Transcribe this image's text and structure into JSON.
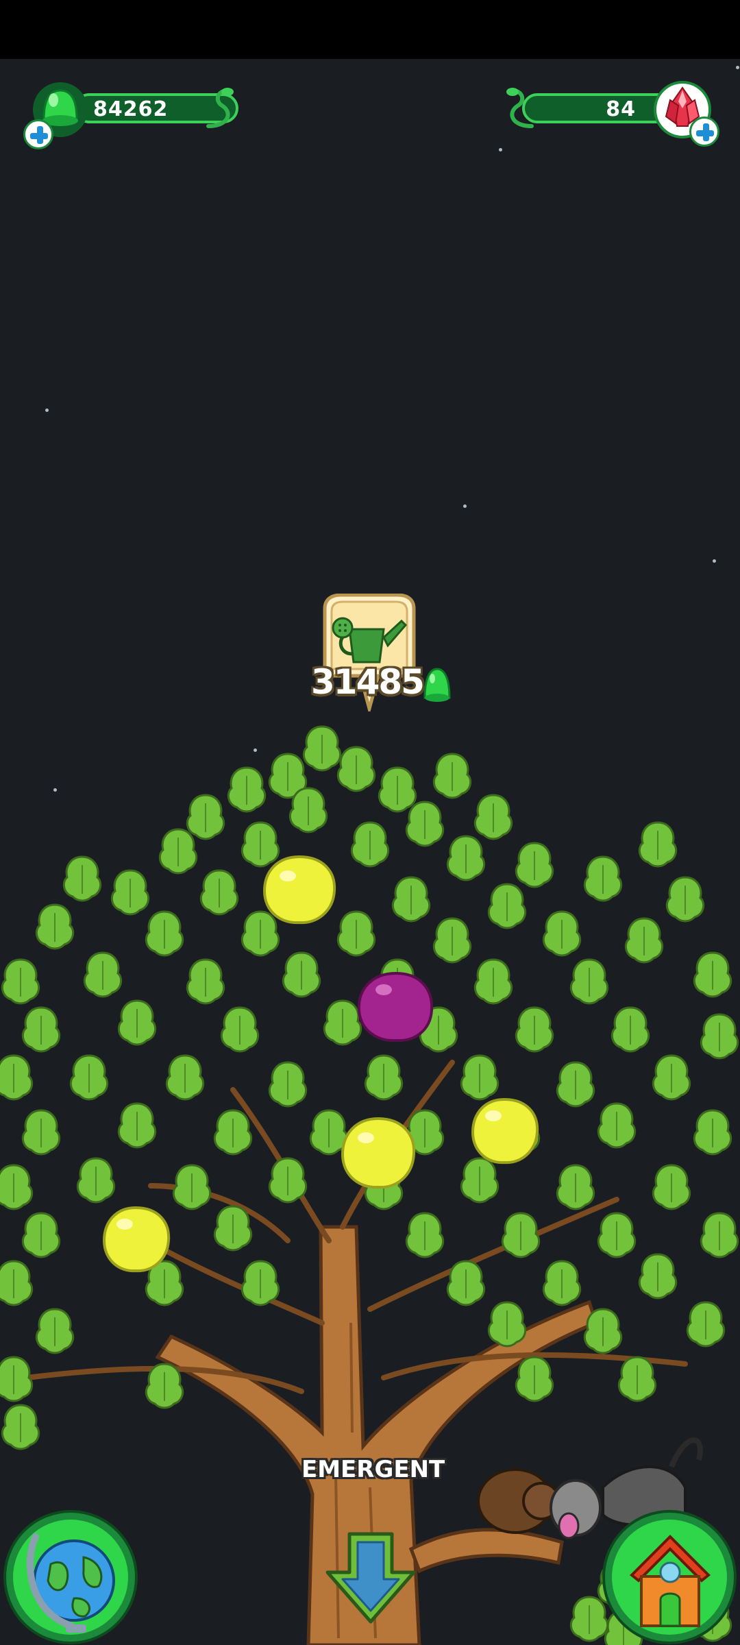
{
  "currencies": {
    "green_gems": {
      "value": "84262",
      "icon": "green-gem-icon"
    },
    "red_crystals": {
      "value": "84",
      "icon": "red-crystal-icon"
    }
  },
  "tree": {
    "water_cost": "31485",
    "water_icon": "watering-can-icon",
    "stage_label": "EMERGENT"
  },
  "fruits": [
    "yellow",
    "purple",
    "yellow",
    "yellow",
    "yellow"
  ],
  "navigation": {
    "left": "globe-icon",
    "center": "down-arrow-icon",
    "right": "house-icon"
  },
  "colors": {
    "background": "#1a1d21",
    "leaf": "#6fbf3a",
    "trunk": "#b8773a",
    "accent_green": "#3ed15a"
  }
}
